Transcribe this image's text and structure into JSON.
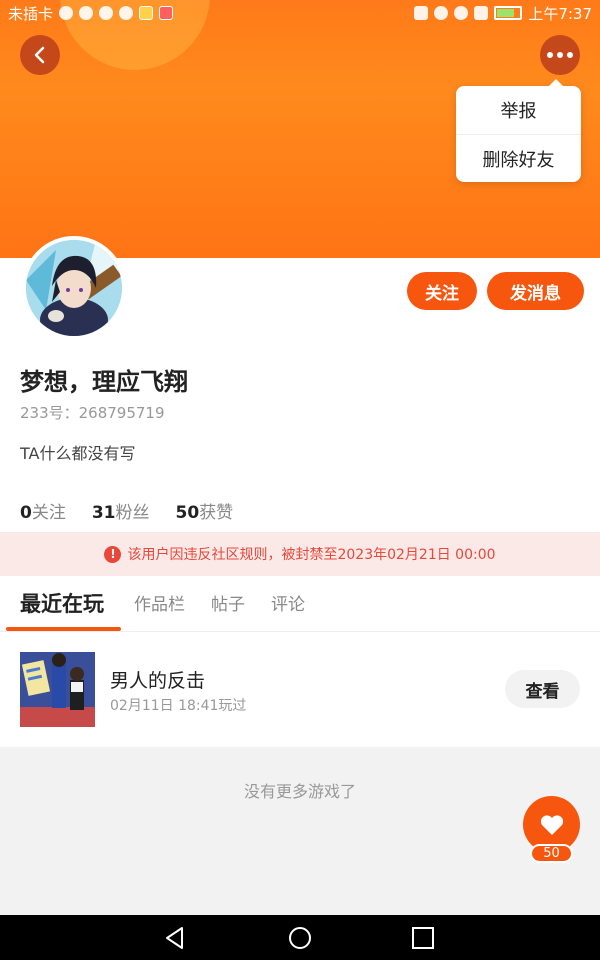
{
  "status_bar": {
    "carrier": "未插卡",
    "time": "上午7:37"
  },
  "header": {
    "back_icon": "chevron-left-icon",
    "more_icon": "more-dots-icon",
    "menu": [
      {
        "label": "举报"
      },
      {
        "label": "删除好友"
      }
    ]
  },
  "profile": {
    "follow_label": "关注",
    "message_label": "发消息",
    "username": "梦想，理应飞翔",
    "uid": "233号：268795719",
    "bio": "TA什么都没有写",
    "stats": [
      {
        "count": "0",
        "label": "关注"
      },
      {
        "count": "31",
        "label": "粉丝"
      },
      {
        "count": "50",
        "label": "获赞"
      }
    ]
  },
  "ban_notice": {
    "icon": "warning-icon",
    "text": "该用户因违反社区规则，被封禁至2023年02月21日 00:00"
  },
  "tabs": [
    {
      "label": "最近在玩",
      "active": true
    },
    {
      "label": "作品栏",
      "active": false
    },
    {
      "label": "帖子",
      "active": false
    },
    {
      "label": "评论",
      "active": false
    }
  ],
  "games": [
    {
      "title": "男人的反击",
      "played_at": "02月11日 18:41玩过",
      "action_label": "查看"
    }
  ],
  "footer_text": "没有更多游戏了",
  "like_fab": {
    "icon": "heart-icon",
    "count": "50"
  },
  "colors": {
    "accent": "#f7560e",
    "header_orange": "#ff7a1a",
    "ban_text": "#e8473a",
    "ban_bg": "#fbe9e7"
  }
}
